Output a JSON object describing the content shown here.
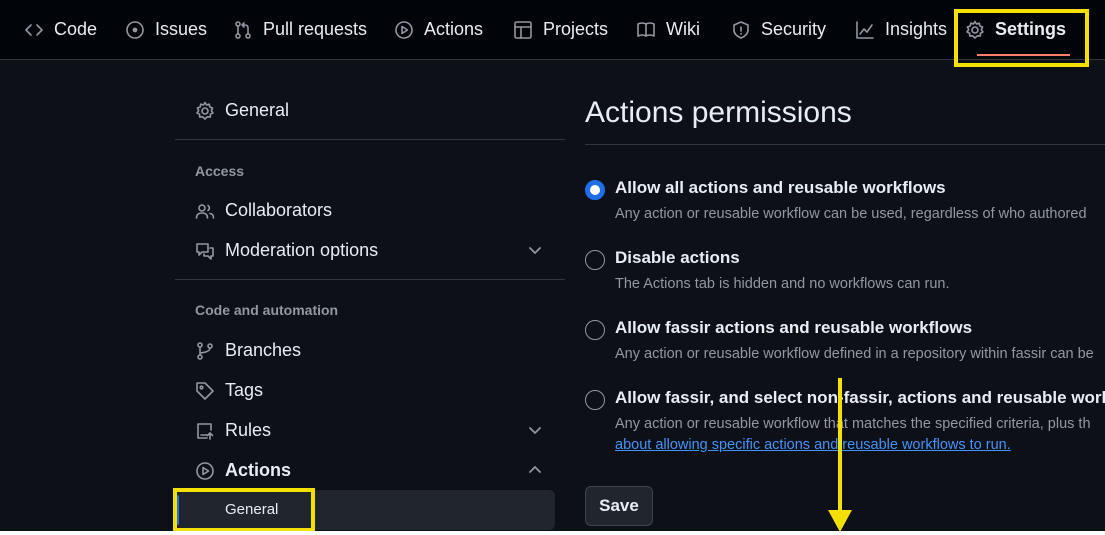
{
  "topnav": {
    "tabs": [
      {
        "label": "Code",
        "icon": "code-icon"
      },
      {
        "label": "Issues",
        "icon": "issue-icon"
      },
      {
        "label": "Pull requests",
        "icon": "pull-request-icon"
      },
      {
        "label": "Actions",
        "icon": "play-icon"
      },
      {
        "label": "Projects",
        "icon": "table-icon"
      },
      {
        "label": "Wiki",
        "icon": "book-icon"
      },
      {
        "label": "Security",
        "icon": "shield-icon"
      },
      {
        "label": "Insights",
        "icon": "graph-icon"
      },
      {
        "label": "Settings",
        "icon": "gear-icon",
        "active": true
      }
    ]
  },
  "sidebar": {
    "general": "General",
    "access_heading": "Access",
    "collaborators": "Collaborators",
    "moderation": "Moderation options",
    "code_heading": "Code and automation",
    "branches": "Branches",
    "tags": "Tags",
    "rules": "Rules",
    "actions": "Actions",
    "actions_general": "General"
  },
  "main": {
    "title": "Actions permissions",
    "options": [
      {
        "title": "Allow all actions and reusable workflows",
        "desc": "Any action or reusable workflow can be used, regardless of who authored",
        "checked": true
      },
      {
        "title": "Disable actions",
        "desc": "The Actions tab is hidden and no workflows can run.",
        "checked": false
      },
      {
        "title": "Allow fassir actions and reusable workflows",
        "desc": "Any action or reusable workflow defined in a repository within fassir can be",
        "checked": false
      },
      {
        "title": "Allow fassir, and select non-fassir, actions and reusable workflows",
        "desc": "Any action or reusable workflow that matches the specified criteria, plus th",
        "link": "about allowing specific actions and reusable workflows to run.",
        "checked": false
      }
    ],
    "save_label": "Save"
  },
  "colors": {
    "background": "#0d1117",
    "nav_background": "#010409",
    "accent_blue": "#1f6feb",
    "link_blue": "#4493f8",
    "active_underline": "#f78166",
    "annotation_yellow": "#f5e003"
  }
}
